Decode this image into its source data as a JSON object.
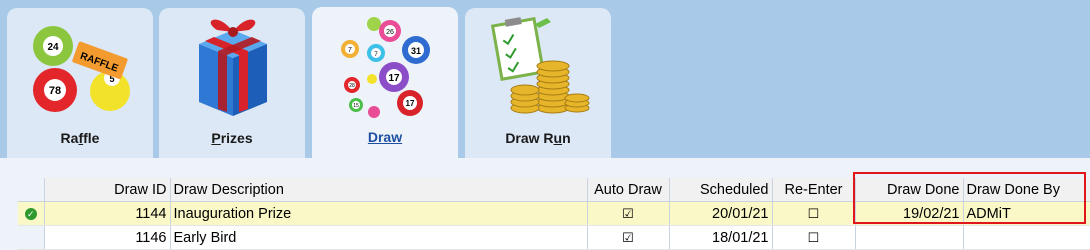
{
  "tabs": [
    {
      "pre": "Ra",
      "u": "f",
      "post": "fle",
      "icon": "raffle-balls-icon",
      "active": false
    },
    {
      "pre": "",
      "u": "P",
      "post": "rizes",
      "icon": "gift-box-icon",
      "active": false
    },
    {
      "pre": "",
      "u": "",
      "post": "Draw",
      "icon": "lottery-balls-icon",
      "active": true
    },
    {
      "pre": "Draw R",
      "u": "u",
      "post": "n",
      "icon": "checklist-coins-icon",
      "active": false
    }
  ],
  "raffle_art": {
    "ball1": "24",
    "ticket": "RAFFLE",
    "ball2": "78",
    "ball3": "5"
  },
  "draw_art": [
    "7",
    "26",
    "31",
    "7",
    "17",
    "17",
    "15",
    "28",
    "17"
  ],
  "table": {
    "columns": [
      "",
      "Draw ID",
      "Draw Description",
      "Auto Draw",
      "Scheduled",
      "Re-Enter",
      "Draw Done",
      "Draw Done By"
    ],
    "rows": [
      {
        "status": "check-icon",
        "id": "1144",
        "desc": "Inauguration Prize",
        "auto": "☑",
        "scheduled": "20/01/21",
        "reenter": "☐",
        "done": "19/02/21",
        "done_by": "ADMiT"
      },
      {
        "status": "",
        "id": "1146",
        "desc": "Early Bird",
        "auto": "☑",
        "scheduled": "18/01/21",
        "reenter": "☐",
        "done": "",
        "done_by": ""
      }
    ]
  },
  "colors": {
    "accent": "#1f4fa3",
    "highlight": "#e0161b",
    "selected_row": "#fbf8c7"
  }
}
